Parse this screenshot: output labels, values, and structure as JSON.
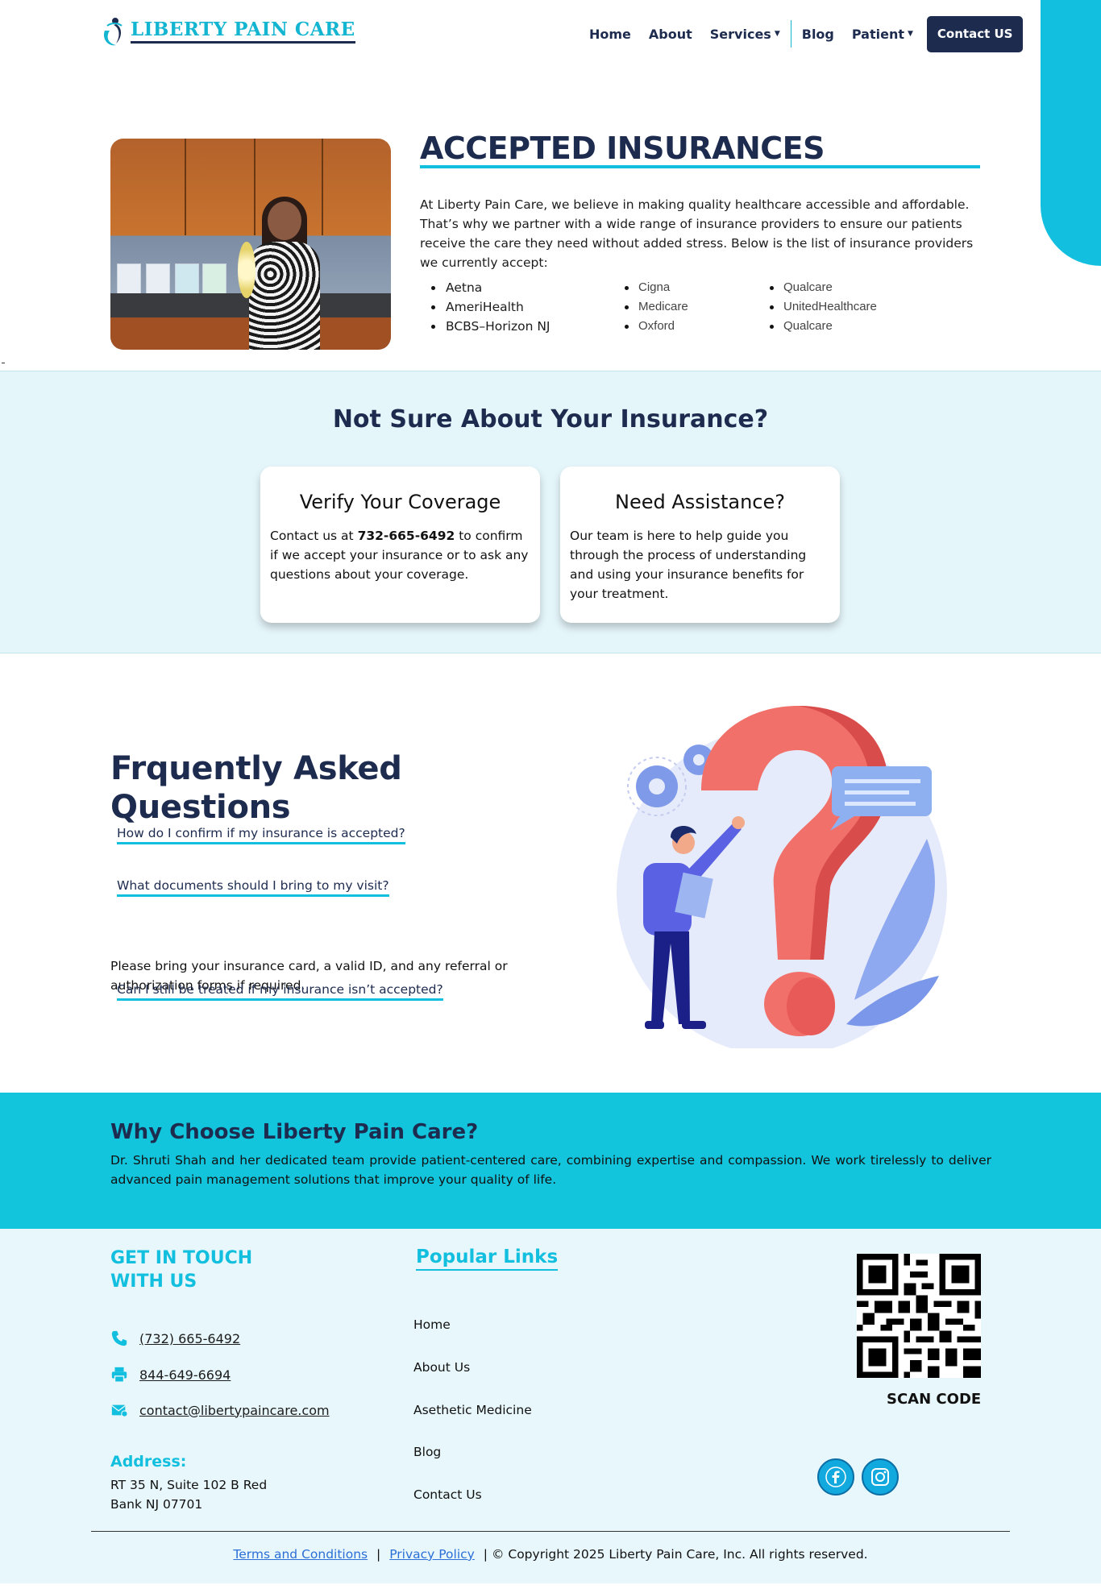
{
  "header": {
    "logo_text": "LIBERTY PAIN CARE",
    "nav": [
      {
        "label": "Home"
      },
      {
        "label": "About"
      },
      {
        "label": "Services"
      },
      {
        "label": "Blog"
      },
      {
        "label": "Patient"
      }
    ],
    "contact_button": "Contact US"
  },
  "insurance": {
    "title": "ACCEPTED INSURANCES",
    "intro": "At Liberty Pain Care, we believe in making quality healthcare accessible and affordable. That’s why we partner with a wide range of insurance providers to ensure our patients receive the care they need without added stress. Below is the list of insurance providers we currently accept:",
    "col_a": [
      "Aetna",
      "AmeriHealth",
      "BCBS–Horizon NJ"
    ],
    "col_b": [
      "Cigna",
      "Medicare",
      "Oxford"
    ],
    "col_c": [
      "Qualcare",
      "UnitedHealthcare",
      "Qualcare"
    ]
  },
  "not_sure": {
    "title": "Not Sure About Your Insurance?",
    "card1": {
      "title": "Verify Your Coverage",
      "text_before": "Contact us at ",
      "phone": "732-665-6492",
      "text_after": " to confirm if we accept your insurance or to ask any questions about your coverage."
    },
    "card2": {
      "title": "Need Assistance?",
      "text": "Our team is here to help guide you through the process of understanding and using your insurance benefits for your treatment."
    }
  },
  "faq": {
    "title": "Frquently Asked Questions",
    "q1": "How do I confirm if my insurance is accepted?",
    "q2": "What documents should I bring to my visit?",
    "a2": "Please bring your insurance card, a valid ID, and any referral or authorization forms if required.",
    "q3": "Can I still be treated if my insurance isn’t accepted?"
  },
  "why": {
    "title": "Why Choose Liberty Pain Care?",
    "text": "Dr. Shruti Shah and her dedicated team provide patient-centered care, combining expertise and compassion. We work tirelessly to deliver advanced pain management solutions that improve your quality of life."
  },
  "footer": {
    "get_in_touch": "GET IN TOUCH WITH US",
    "phone": "(732) 665-6492",
    "fax": "844-649-6694",
    "email": "contact@libertypaincare.com",
    "address_title": "Address:",
    "address_line1": "RT 35 N, Suite 102 B Red",
    "address_line2": "Bank NJ 07701",
    "popular_links_title": "Popular Links",
    "links": [
      "Home",
      "About Us",
      "Asethetic Medicine",
      "Blog",
      "Contact Us"
    ],
    "scan_code": "SCAN CODE",
    "terms": "Terms and Conditions",
    "privacy": "Privacy Policy",
    "copyright": "| © Copyright 2025 Liberty Pain Care, Inc. All rights reserved.",
    "separator": "|"
  },
  "colors": {
    "accent": "#12bfde",
    "navy": "#1d2b4f",
    "light_bg": "#e5f6fb"
  },
  "icons": [
    "phone-icon",
    "fax-icon",
    "email-icon",
    "facebook-icon",
    "instagram-icon",
    "qr-code",
    "chevron-down-icon"
  ]
}
